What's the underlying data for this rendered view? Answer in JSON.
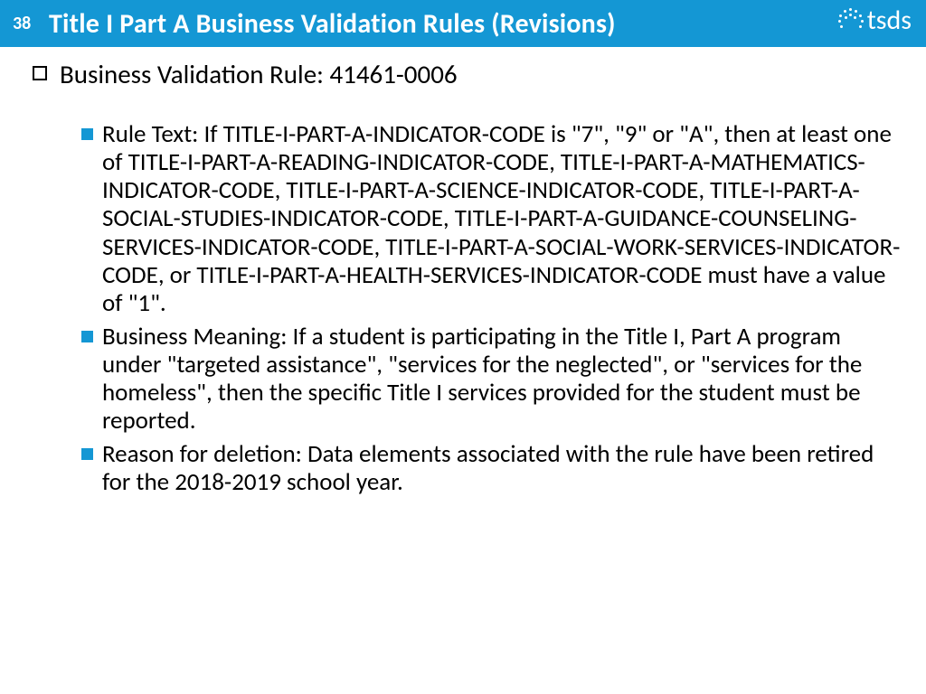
{
  "header": {
    "page_number": "38",
    "title": "Title I Part A Business Validation Rules (Revisions)",
    "logo_text": "tsds"
  },
  "level1": {
    "text": "Business Validation Rule:  41461-0006"
  },
  "level2": [
    {
      "text": "Rule Text:  If TITLE-I-PART-A-INDICATOR-CODE is \"7\", \"9\" or \"A\", then at least one of TITLE-I-PART-A-READING-INDICATOR-CODE, TITLE-I-PART-A-MATHEMATICS-INDICATOR-CODE, TITLE-I-PART-A-SCIENCE-INDICATOR-CODE, TITLE-I-PART-A-SOCIAL-STUDIES-INDICATOR-CODE, TITLE-I-PART-A-GUIDANCE-COUNSELING-SERVICES-INDICATOR-CODE, TITLE-I-PART-A-SOCIAL-WORK-SERVICES-INDICATOR-CODE, or TITLE-I-PART-A-HEALTH-SERVICES-INDICATOR-CODE must have a value of \"1\"."
    },
    {
      "text": "Business Meaning:  If a student is participating in the Title I, Part A program under \"targeted assistance\", \"services for the neglected\", or \"services for the homeless\", then the specific Title I services provided for the student must be reported."
    },
    {
      "text": "Reason for deletion:  Data elements associated with the rule have been retired for the 2018-2019 school year."
    }
  ]
}
